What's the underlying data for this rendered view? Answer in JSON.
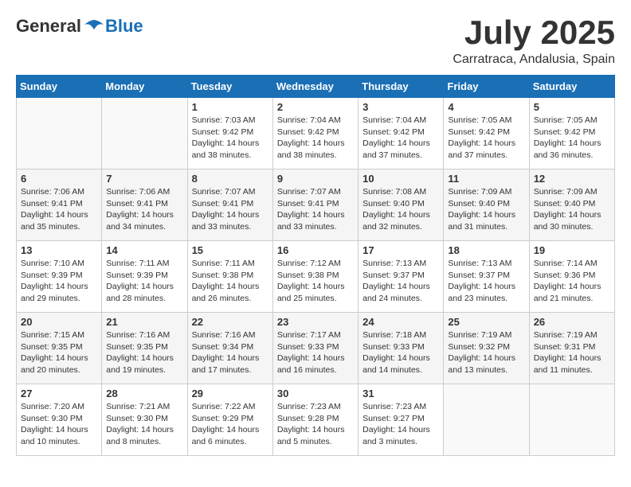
{
  "header": {
    "logo_general": "General",
    "logo_blue": "Blue",
    "month_title": "July 2025",
    "location": "Carratraca, Andalusia, Spain"
  },
  "weekdays": [
    "Sunday",
    "Monday",
    "Tuesday",
    "Wednesday",
    "Thursday",
    "Friday",
    "Saturday"
  ],
  "weeks": [
    [
      {
        "day": "",
        "content": ""
      },
      {
        "day": "",
        "content": ""
      },
      {
        "day": "1",
        "content": "Sunrise: 7:03 AM\nSunset: 9:42 PM\nDaylight: 14 hours and 38 minutes."
      },
      {
        "day": "2",
        "content": "Sunrise: 7:04 AM\nSunset: 9:42 PM\nDaylight: 14 hours and 38 minutes."
      },
      {
        "day": "3",
        "content": "Sunrise: 7:04 AM\nSunset: 9:42 PM\nDaylight: 14 hours and 37 minutes."
      },
      {
        "day": "4",
        "content": "Sunrise: 7:05 AM\nSunset: 9:42 PM\nDaylight: 14 hours and 37 minutes."
      },
      {
        "day": "5",
        "content": "Sunrise: 7:05 AM\nSunset: 9:42 PM\nDaylight: 14 hours and 36 minutes."
      }
    ],
    [
      {
        "day": "6",
        "content": "Sunrise: 7:06 AM\nSunset: 9:41 PM\nDaylight: 14 hours and 35 minutes."
      },
      {
        "day": "7",
        "content": "Sunrise: 7:06 AM\nSunset: 9:41 PM\nDaylight: 14 hours and 34 minutes."
      },
      {
        "day": "8",
        "content": "Sunrise: 7:07 AM\nSunset: 9:41 PM\nDaylight: 14 hours and 33 minutes."
      },
      {
        "day": "9",
        "content": "Sunrise: 7:07 AM\nSunset: 9:41 PM\nDaylight: 14 hours and 33 minutes."
      },
      {
        "day": "10",
        "content": "Sunrise: 7:08 AM\nSunset: 9:40 PM\nDaylight: 14 hours and 32 minutes."
      },
      {
        "day": "11",
        "content": "Sunrise: 7:09 AM\nSunset: 9:40 PM\nDaylight: 14 hours and 31 minutes."
      },
      {
        "day": "12",
        "content": "Sunrise: 7:09 AM\nSunset: 9:40 PM\nDaylight: 14 hours and 30 minutes."
      }
    ],
    [
      {
        "day": "13",
        "content": "Sunrise: 7:10 AM\nSunset: 9:39 PM\nDaylight: 14 hours and 29 minutes."
      },
      {
        "day": "14",
        "content": "Sunrise: 7:11 AM\nSunset: 9:39 PM\nDaylight: 14 hours and 28 minutes."
      },
      {
        "day": "15",
        "content": "Sunrise: 7:11 AM\nSunset: 9:38 PM\nDaylight: 14 hours and 26 minutes."
      },
      {
        "day": "16",
        "content": "Sunrise: 7:12 AM\nSunset: 9:38 PM\nDaylight: 14 hours and 25 minutes."
      },
      {
        "day": "17",
        "content": "Sunrise: 7:13 AM\nSunset: 9:37 PM\nDaylight: 14 hours and 24 minutes."
      },
      {
        "day": "18",
        "content": "Sunrise: 7:13 AM\nSunset: 9:37 PM\nDaylight: 14 hours and 23 minutes."
      },
      {
        "day": "19",
        "content": "Sunrise: 7:14 AM\nSunset: 9:36 PM\nDaylight: 14 hours and 21 minutes."
      }
    ],
    [
      {
        "day": "20",
        "content": "Sunrise: 7:15 AM\nSunset: 9:35 PM\nDaylight: 14 hours and 20 minutes."
      },
      {
        "day": "21",
        "content": "Sunrise: 7:16 AM\nSunset: 9:35 PM\nDaylight: 14 hours and 19 minutes."
      },
      {
        "day": "22",
        "content": "Sunrise: 7:16 AM\nSunset: 9:34 PM\nDaylight: 14 hours and 17 minutes."
      },
      {
        "day": "23",
        "content": "Sunrise: 7:17 AM\nSunset: 9:33 PM\nDaylight: 14 hours and 16 minutes."
      },
      {
        "day": "24",
        "content": "Sunrise: 7:18 AM\nSunset: 9:33 PM\nDaylight: 14 hours and 14 minutes."
      },
      {
        "day": "25",
        "content": "Sunrise: 7:19 AM\nSunset: 9:32 PM\nDaylight: 14 hours and 13 minutes."
      },
      {
        "day": "26",
        "content": "Sunrise: 7:19 AM\nSunset: 9:31 PM\nDaylight: 14 hours and 11 minutes."
      }
    ],
    [
      {
        "day": "27",
        "content": "Sunrise: 7:20 AM\nSunset: 9:30 PM\nDaylight: 14 hours and 10 minutes."
      },
      {
        "day": "28",
        "content": "Sunrise: 7:21 AM\nSunset: 9:30 PM\nDaylight: 14 hours and 8 minutes."
      },
      {
        "day": "29",
        "content": "Sunrise: 7:22 AM\nSunset: 9:29 PM\nDaylight: 14 hours and 6 minutes."
      },
      {
        "day": "30",
        "content": "Sunrise: 7:23 AM\nSunset: 9:28 PM\nDaylight: 14 hours and 5 minutes."
      },
      {
        "day": "31",
        "content": "Sunrise: 7:23 AM\nSunset: 9:27 PM\nDaylight: 14 hours and 3 minutes."
      },
      {
        "day": "",
        "content": ""
      },
      {
        "day": "",
        "content": ""
      }
    ]
  ]
}
